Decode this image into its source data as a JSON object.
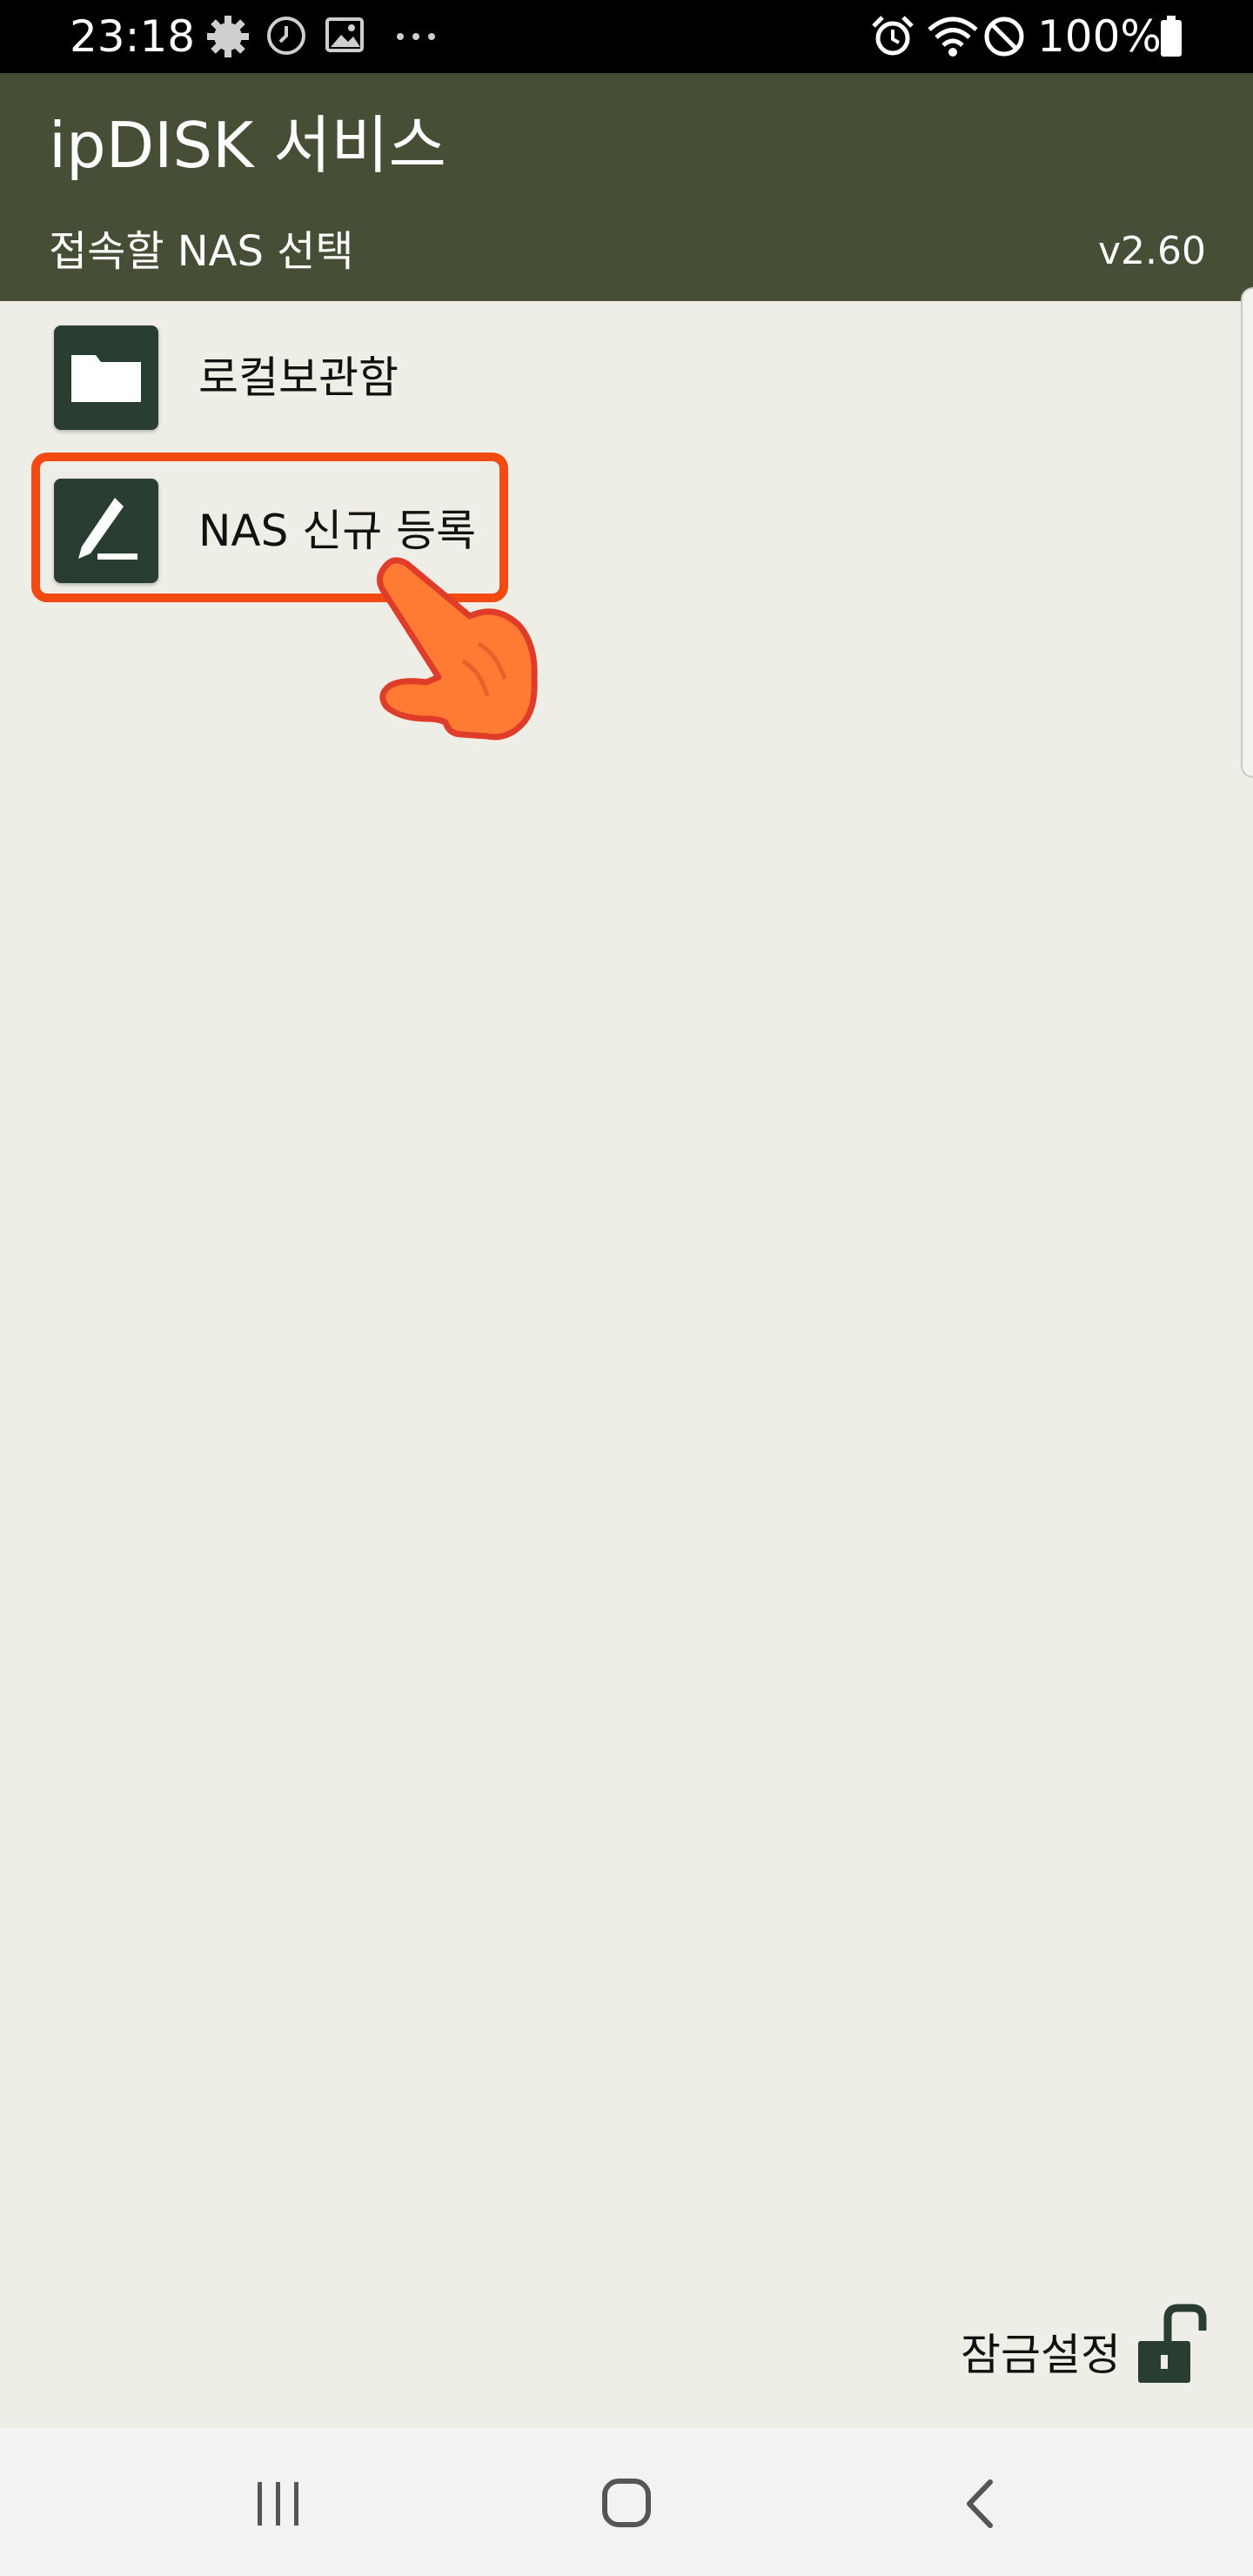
{
  "status_bar": {
    "time": "23:18",
    "battery_percent": "100%",
    "icons": [
      "settings-gear-icon",
      "clock-icon",
      "gallery-image-icon",
      "more-dots-icon",
      "alarm-icon",
      "wifi-icon",
      "do-not-disturb-icon",
      "battery-icon"
    ]
  },
  "app_bar": {
    "title": "ipDISK 서비스",
    "subtitle": "접속할 NAS 선택",
    "version": "v2.60",
    "background_color": "#464f36"
  },
  "list": {
    "items": [
      {
        "label": "로컬보관함",
        "icon": "folder-icon"
      },
      {
        "label": "NAS 신규 등록",
        "icon": "pen-edit-icon",
        "highlighted": true
      }
    ]
  },
  "footer": {
    "lock_label": "잠금설정",
    "lock_icon": "unlocked-padlock-icon"
  },
  "nav_bar": {
    "buttons": [
      "recent-apps-icon",
      "home-icon",
      "back-icon"
    ]
  },
  "colors": {
    "highlight": "#f24a12",
    "hand_pointer": "#ff7a33",
    "icon_tile": "#2a3d31",
    "background": "#eeeee6"
  }
}
